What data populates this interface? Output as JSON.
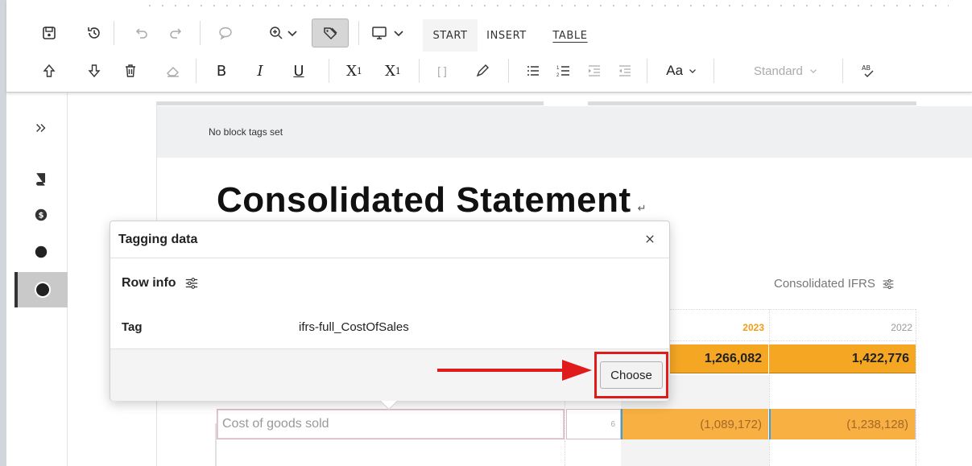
{
  "toolbar": {
    "menu_tabs": [
      "START",
      "INSERT",
      "TABLE"
    ],
    "style_select": "Standard",
    "colors": {
      "accent_orange": "#f5a623",
      "highlight_red": "#e01b1b"
    }
  },
  "document": {
    "block_tags_text": "No block tags set",
    "heading": "Consolidated Statement",
    "ifrs_label": "Consolidated IFRS",
    "years": [
      "2023",
      "2022"
    ],
    "rows": [
      {
        "label": "",
        "values": [
          "1,266,082",
          "1,422,776"
        ]
      },
      {
        "label": "Cost of goods sold",
        "index": "6",
        "values": [
          "(1,089,172)",
          "(1,238,128)"
        ]
      }
    ]
  },
  "popup": {
    "title": "Tagging data",
    "section": "Row info",
    "tag_label": "Tag",
    "tag_value": "ifrs-full_CostOfSales",
    "choose_label": "Choose"
  }
}
